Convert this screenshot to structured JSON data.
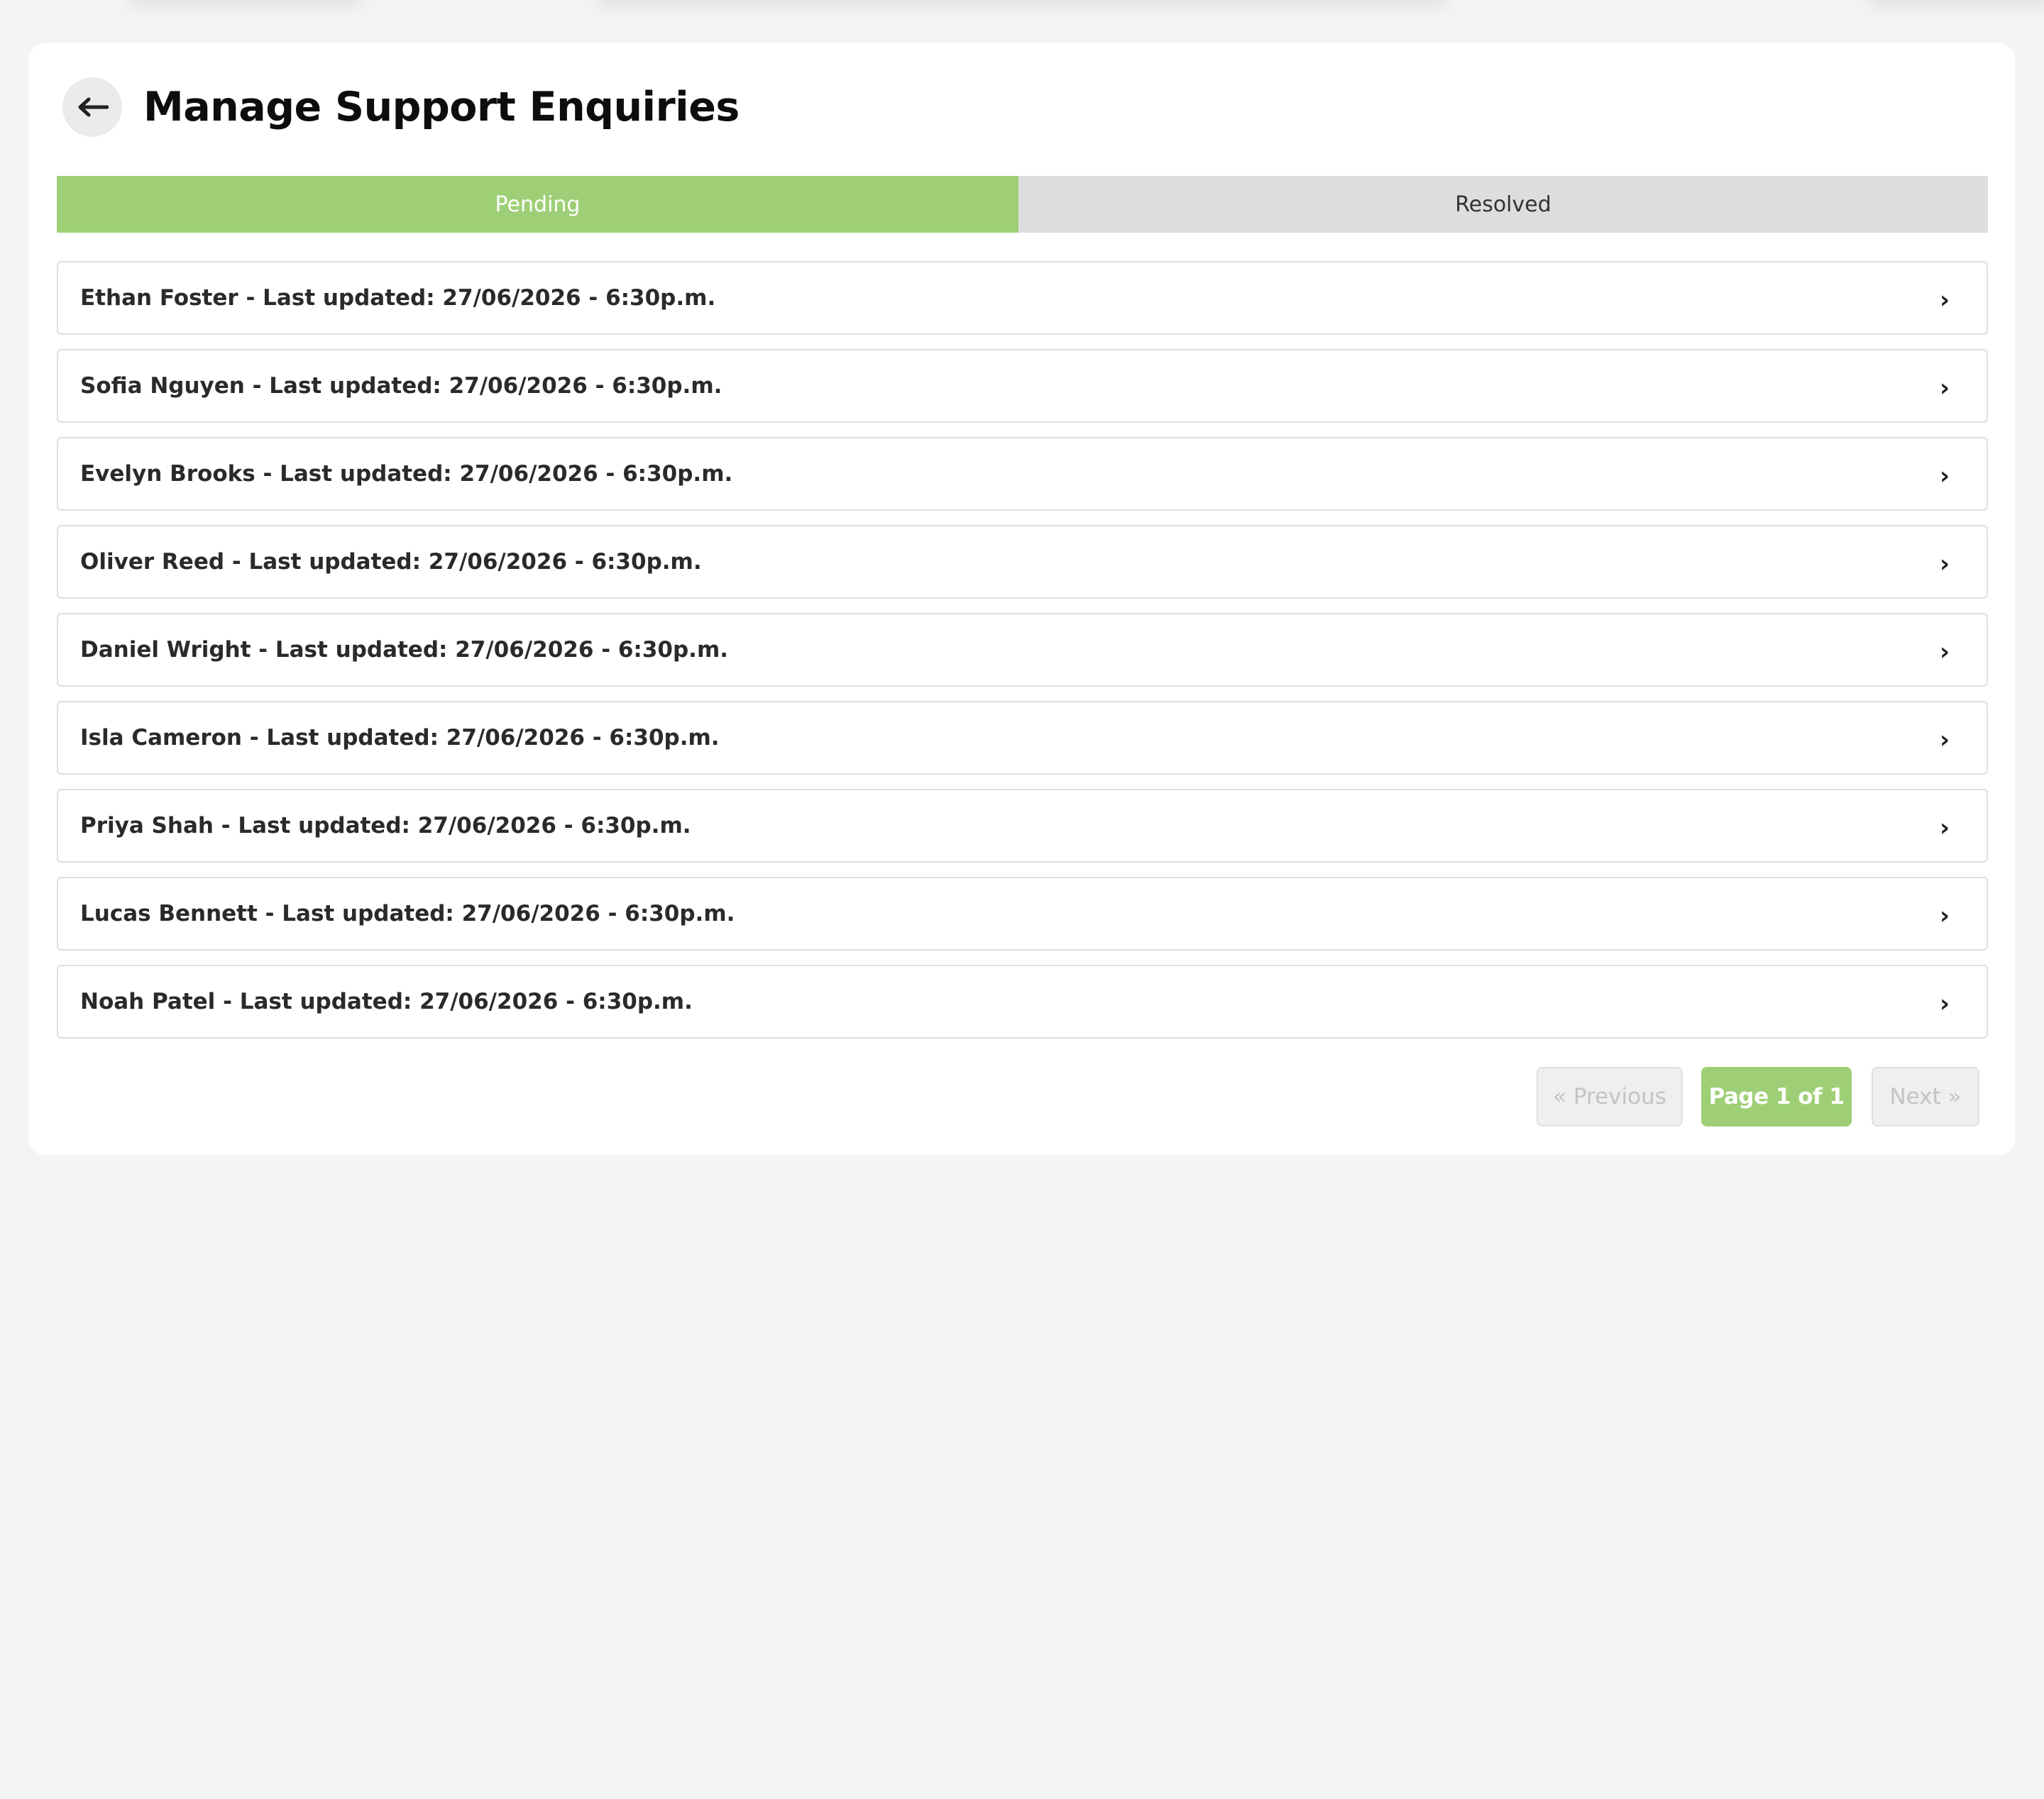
{
  "header": {
    "title": "Manage Support Enquiries",
    "back_icon": "arrow-left-icon"
  },
  "tabs": [
    {
      "label": "Pending",
      "active": true
    },
    {
      "label": "Resolved",
      "active": false
    }
  ],
  "enquiries": [
    {
      "label": "Ethan Foster - Last updated: 27/06/2026 - 6:30p.m."
    },
    {
      "label": "Sofia Nguyen - Last updated: 27/06/2026 - 6:30p.m."
    },
    {
      "label": "Evelyn Brooks - Last updated: 27/06/2026 - 6:30p.m."
    },
    {
      "label": "Oliver Reed - Last updated: 27/06/2026 - 6:30p.m."
    },
    {
      "label": "Daniel Wright - Last updated: 27/06/2026 - 6:30p.m."
    },
    {
      "label": "Isla Cameron - Last updated: 27/06/2026 - 6:30p.m."
    },
    {
      "label": "Priya Shah - Last updated: 27/06/2026 - 6:30p.m."
    },
    {
      "label": "Lucas Bennett - Last updated: 27/06/2026 - 6:30p.m."
    },
    {
      "label": "Noah Patel - Last updated: 27/06/2026 - 6:30p.m."
    }
  ],
  "item_chevron": "›",
  "pagination": {
    "previous": "« Previous",
    "current": "Page 1 of 1",
    "next": "Next »"
  },
  "colors": {
    "accent": "#9ecf76",
    "tab_inactive": "#dddddd",
    "background": "#f4f4f4"
  }
}
